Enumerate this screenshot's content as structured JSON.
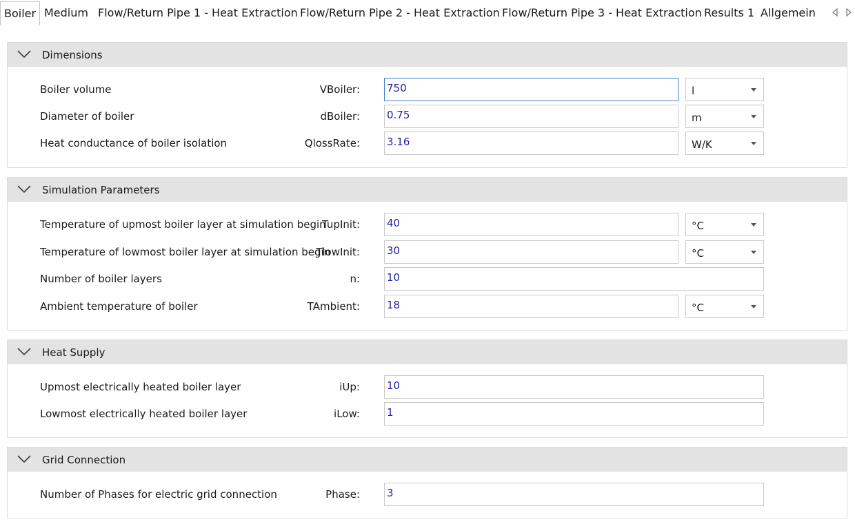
{
  "tabs": [
    {
      "label": "Boiler",
      "active": true
    },
    {
      "label": "Medium",
      "active": false
    },
    {
      "label": "Flow/Return Pipe 1 - Heat Extraction",
      "active": false
    },
    {
      "label": "Flow/Return Pipe 2 - Heat Extraction",
      "active": false
    },
    {
      "label": "Flow/Return Pipe 3 - Heat Extraction",
      "active": false
    },
    {
      "label": "Results 1",
      "active": false
    },
    {
      "label": "Allgemein",
      "active": false
    }
  ],
  "tab_scroll": {
    "left_icon": "triangle-left-icon",
    "right_icon": "triangle-right-icon"
  },
  "groups": [
    {
      "title": "Dimensions",
      "rows": [
        {
          "label": "Boiler volume",
          "variable": "VBoiler:",
          "value": "750",
          "unit": "l"
        },
        {
          "label": "Diameter of boiler",
          "variable": "dBoiler:",
          "value": "0.75",
          "unit": "m"
        },
        {
          "label": "Heat conductance of boiler isolation",
          "variable": "QlossRate:",
          "value": "3.16",
          "unit": "W/K"
        }
      ]
    },
    {
      "title": "Simulation Parameters",
      "rows": [
        {
          "label": "Temperature of upmost boiler layer at simulation begin",
          "variable": "TupInit:",
          "value": "40",
          "unit": "°C"
        },
        {
          "label": "Temperature of lowmost boiler layer at simulation begin",
          "variable": "TlowInit:",
          "value": "30",
          "unit": "°C"
        },
        {
          "label": "Number of boiler layers",
          "variable": "n:",
          "value": "10",
          "unit": ""
        },
        {
          "label": "Ambient temperature of boiler",
          "variable": "TAmbient:",
          "value": "18",
          "unit": "°C"
        }
      ]
    },
    {
      "title": "Heat Supply",
      "rows": [
        {
          "label": "Upmost electrically heated boiler layer",
          "variable": "iUp:",
          "value": "10",
          "unit": ""
        },
        {
          "label": "Lowmost electrically heated boiler layer",
          "variable": "iLow:",
          "value": "1",
          "unit": ""
        }
      ]
    },
    {
      "title": "Grid Connection",
      "rows": [
        {
          "label": "Number of Phases for electric grid connection",
          "variable": "Phase:",
          "value": "3",
          "unit": ""
        }
      ]
    }
  ],
  "colors": {
    "header_bg": "#e3e3e3",
    "value_text": "#1f1fa8",
    "focus_border": "#3a7fc4"
  }
}
